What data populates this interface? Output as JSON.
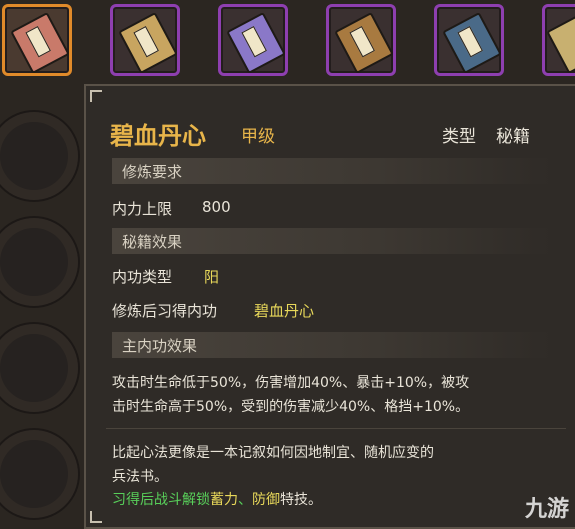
{
  "skill": {
    "name": "碧血丹心",
    "grade": "甲级",
    "type_label": "类型",
    "type_value": "秘籍"
  },
  "requirements": {
    "header": "修炼要求",
    "items": [
      {
        "label": "内力上限",
        "value": "800"
      }
    ]
  },
  "effects": {
    "header": "秘籍效果",
    "inner_type_label": "内功类型",
    "inner_type_value": "阳",
    "learn_label": "修炼后习得内功",
    "learn_value": "碧血丹心"
  },
  "main_effect": {
    "header": "主内功效果",
    "line1": "攻击时生命低于50%，伤害增加40%、暴击+10%，被攻",
    "line2": "击时生命高于50%，受到的伤害减少40%、格挡+10%。"
  },
  "description": {
    "line1": "比起心法更像是一本记叙如何因地制宜、随机应变的",
    "line2": "兵法书。",
    "line3_prefix": "习得后战斗解锁",
    "skill1": "蓄力",
    "sep": "、",
    "skill2": "防御",
    "line3_suffix": "特技。"
  },
  "watermark": "九游",
  "colors": {
    "slot_border": "#8e3fb0",
    "slot_selected": "#e08a2a",
    "title": "#e8b54a",
    "highlight_green": "#58d05a"
  },
  "icons": [
    "book-icon-red",
    "book-icon-tan",
    "book-icon-purple",
    "book-icon-brown",
    "book-icon-blue",
    "book-icon-partial"
  ]
}
